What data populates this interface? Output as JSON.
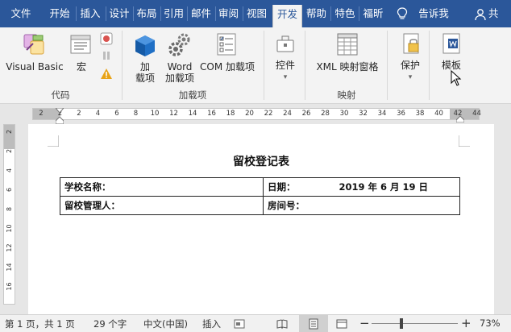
{
  "tabs": [
    {
      "label": "文件"
    },
    {
      "label": "开始"
    },
    {
      "label": "插入"
    },
    {
      "label": "设计"
    },
    {
      "label": "布局"
    },
    {
      "label": "引用"
    },
    {
      "label": "邮件"
    },
    {
      "label": "审阅"
    },
    {
      "label": "视图"
    },
    {
      "label": "开发"
    },
    {
      "label": "帮助"
    },
    {
      "label": "特色"
    },
    {
      "label": "福昕"
    }
  ],
  "tell_me": "告诉我",
  "share": "共",
  "ribbon": {
    "code": {
      "label": "代码",
      "visual_basic": "Visual Basic",
      "macros": "宏"
    },
    "addins": {
      "label": "加载项",
      "addins_line1": "加",
      "addins_line2": "载项",
      "word_addins_line1": "Word",
      "word_addins_line2": "加载项",
      "com_addins": "COM 加载项"
    },
    "controls": {
      "label": "控件",
      "chevron": "▾"
    },
    "mapping": {
      "label": "映射",
      "xml_pane": "XML 映射窗格"
    },
    "protect": {
      "label": "保护",
      "chevron": "▾"
    },
    "templates": {
      "label": "模板"
    }
  },
  "ruler": {
    "h_numbers": [
      "2",
      "2",
      "2",
      "4",
      "6",
      "8",
      "10",
      "12",
      "14",
      "16",
      "18",
      "20",
      "22",
      "24",
      "26",
      "28",
      "30",
      "32",
      "34",
      "36",
      "38",
      "40",
      "42",
      "44"
    ],
    "v_numbers": [
      "2",
      "2",
      "4",
      "6",
      "8",
      "10",
      "12",
      "14",
      "16"
    ]
  },
  "document": {
    "title": "留校登记表",
    "rows": [
      {
        "left": "学校名称：",
        "right": "日期：",
        "right_value": "2019 年 6 月 19 日"
      },
      {
        "left": "留校管理人：",
        "right": "房间号：",
        "right_value": ""
      }
    ]
  },
  "status": {
    "page": "第 1 页，共 1 页",
    "words": "29 个字",
    "language": "中文(中国)",
    "mode": "插入",
    "zoom": "73%",
    "zoom_minus": "−",
    "zoom_plus": "+"
  },
  "colors": {
    "accent": "#2b579a",
    "ribbon_bg": "#f3f3f3",
    "addins_icon": "#1f6fc5",
    "warning": "#e8a317"
  }
}
